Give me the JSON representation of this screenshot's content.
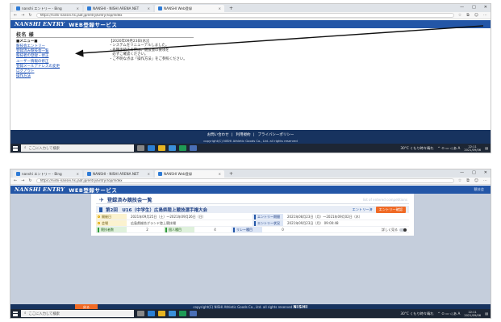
{
  "browser": {
    "tabs": [
      {
        "label": "nanshi エントリー - Bing"
      },
      {
        "label": "NANSHI - NISHI ARENA NET"
      },
      {
        "label": "NANSHI Web登録"
      }
    ],
    "new_tab": "+",
    "url": "https://nishi-nansei.hs.jaaf.jp/entry/Entry/Top/Index",
    "win_min": "—",
    "win_max": "□",
    "win_close": "✕"
  },
  "site": {
    "logo": "NANSHI ENTRY",
    "service_title": "WEB登録サービス",
    "header_right": "競技会"
  },
  "screen1": {
    "title": "校名 様",
    "menu_header": "■メニュー■",
    "menu_items": [
      {
        "label": "競技会エントリー"
      },
      {
        "label": "登録済み競技会一覧"
      },
      {
        "label": "競技者の登録・修正"
      },
      {
        "label": "ユーザー情報の修正"
      },
      {
        "label": "登録メールアドレスの変更"
      },
      {
        "label": "ログアウト"
      },
      {
        "label": "操作方法"
      }
    ],
    "notice_lines": [
      "【2020年09月23日(水)】",
      "・システムをリニューアルしました。",
      "・各種手続きの際は、競技会の要項を",
      "　必ずご確認ください。",
      "・ご不明な点は「操作方法」をご参照ください。"
    ],
    "footer_links": [
      {
        "label": "お問い合わせ"
      },
      {
        "label": "利用規約"
      },
      {
        "label": "プライバシーポリシー"
      }
    ],
    "footer_copyright": "copyright(C) NISHI Athletic Goods Co., Ltd. all rights reserved"
  },
  "screen2": {
    "page_title": "登録済み競技会一覧",
    "page_subtitle": "list of entered competitions",
    "event_name": "第2回　U16（中学生）広島県陸上競技選手権大会",
    "entry_button": "エントリー済",
    "final_button": "エントリー確認",
    "rows": [
      {
        "label1": "開催日",
        "value1": "2021年09月25日（土）〜2021年09月26日（日）",
        "label2": "エントリー期間",
        "value2": "2021年08月23日（月）〜2021年09月02日（木）"
      },
      {
        "label1": "会場",
        "value1": "広島県総合グランド陸上競技場",
        "label2": "エントリー状況",
        "value2": "2021年09月23日（月） 09:00:48"
      }
    ],
    "count_row": {
      "label_a": "競技者数",
      "value_a": "2",
      "label_b": "個人種目",
      "value_b": "4",
      "label_c": "リレー種目",
      "value_c": "0",
      "toggle_label": "詳しく見る"
    },
    "back_button": "戻る",
    "footer_copyright": "copyright(C) NISHI Athletic Goods Co., Ltd. all rights reserved",
    "footer_brand": "NISHI"
  },
  "taskbar": {
    "search_placeholder": "ここに入力して検索",
    "weather": "30°C くもり時々晴れ",
    "time": "22:11",
    "date": "2021/09/06"
  },
  "colors": {
    "header_blue": "#2356a7",
    "footer_navy": "#17335f",
    "accent_orange": "#f06a25",
    "link_blue": "#1a4fb5"
  }
}
